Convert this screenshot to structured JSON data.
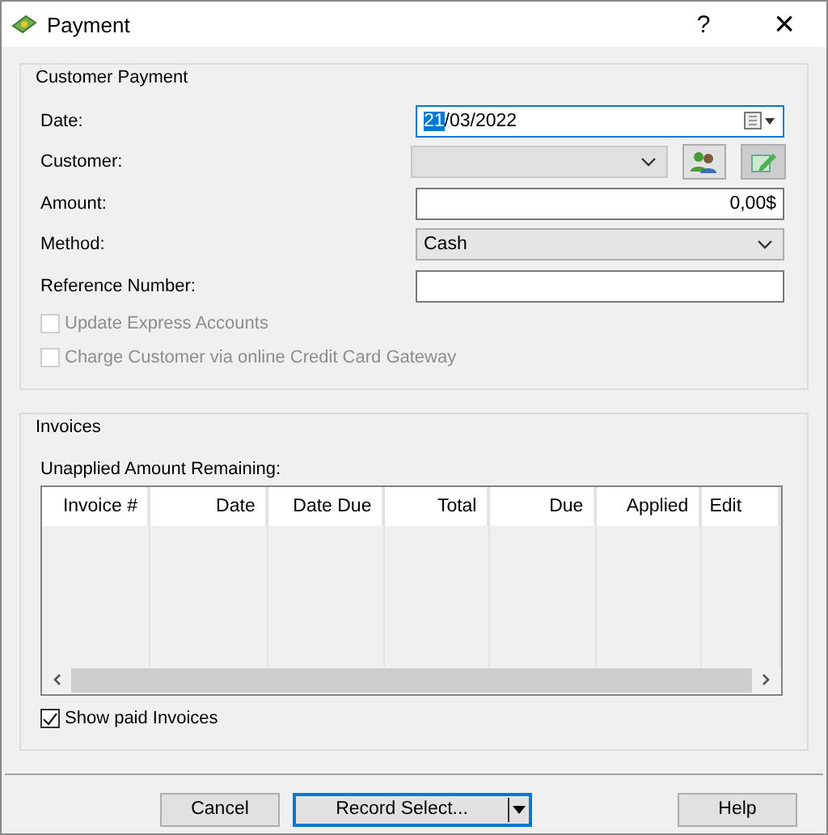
{
  "window": {
    "title": "Payment",
    "help": "?",
    "close": "×"
  },
  "customer_payment": {
    "title": "Customer Payment",
    "fields": [
      {
        "kind": "date",
        "label": "Date:",
        "selection": "21",
        "value": "/03/2022"
      },
      {
        "kind": "customer",
        "label": "Customer:",
        "disabled": true
      },
      {
        "kind": "amount",
        "label": "Amount:",
        "value": "0,00$"
      },
      {
        "kind": "select",
        "label": "Method:",
        "value": "Cash"
      },
      {
        "kind": "text",
        "label": "Reference Number:"
      }
    ],
    "options": [
      {
        "label": "Update Express Accounts",
        "checked": false,
        "disabled": true
      },
      {
        "label": "Charge Customer via online Credit Card Gateway",
        "checked": false,
        "disabled": true
      }
    ]
  },
  "invoices": {
    "title": "Invoices",
    "unapplied_label": "Unapplied Amount Remaining:",
    "columns": [
      "Invoice #",
      "Date",
      "Date Due",
      "Total",
      "Due",
      "Applied",
      "Edit"
    ],
    "show_paid": {
      "label": "Show paid Invoices",
      "checked": true
    }
  },
  "buttons": [
    {
      "label": "Cancel",
      "kind": "plain"
    },
    {
      "label": "Record Select...",
      "kind": "split"
    },
    {
      "label": "Help",
      "kind": "plain"
    }
  ]
}
